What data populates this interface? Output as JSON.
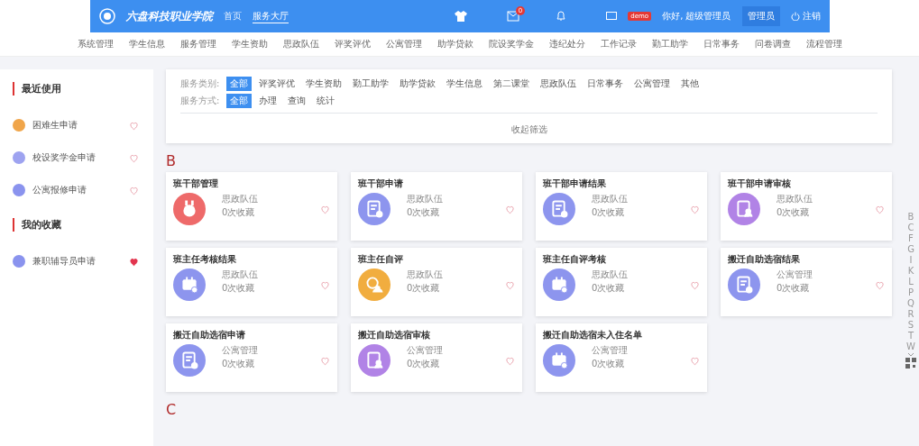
{
  "header": {
    "school_name": "六盘科技职业学院",
    "nav": [
      {
        "label": "首页",
        "selected": false
      },
      {
        "label": "服务大厅",
        "selected": true
      }
    ],
    "mail_badge": "0",
    "demo_badge": "demo",
    "greeting": "你好, 超级管理员",
    "role": "管理员",
    "logout": "注销"
  },
  "menu": [
    "系统管理",
    "学生信息",
    "服务管理",
    "学生资助",
    "思政队伍",
    "评奖评优",
    "公寓管理",
    "助学贷款",
    "院设奖学金",
    "违纪处分",
    "工作记录",
    "勤工助学",
    "日常事务",
    "问卷调查",
    "流程管理"
  ],
  "sidebar": {
    "sections": [
      {
        "title": "最近使用",
        "items": [
          {
            "label": "困难生申请",
            "color": "#f0a54a",
            "favorited": false
          },
          {
            "label": "校设奖学金申请",
            "color": "#9ea3f0",
            "favorited": false
          },
          {
            "label": "公寓报修申请",
            "color": "#8a93ee",
            "favorited": false
          }
        ]
      },
      {
        "title": "我的收藏",
        "items": [
          {
            "label": "兼职辅导员申请",
            "color": "#8a93ee",
            "favorited": true
          }
        ]
      }
    ]
  },
  "filters": [
    {
      "label": "服务类别:",
      "options": [
        {
          "label": "全部",
          "selected": true
        },
        {
          "label": "评奖评优",
          "selected": false
        },
        {
          "label": "学生资助",
          "selected": false
        },
        {
          "label": "勤工助学",
          "selected": false
        },
        {
          "label": "助学贷款",
          "selected": false
        },
        {
          "label": "学生信息",
          "selected": false
        },
        {
          "label": "第二课堂",
          "selected": false
        },
        {
          "label": "思政队伍",
          "selected": false
        },
        {
          "label": "日常事务",
          "selected": false
        },
        {
          "label": "公寓管理",
          "selected": false
        },
        {
          "label": "其他",
          "selected": false
        }
      ]
    },
    {
      "label": "服务方式:",
      "options": [
        {
          "label": "全部",
          "selected": true
        },
        {
          "label": "办理",
          "selected": false
        },
        {
          "label": "查询",
          "selected": false
        },
        {
          "label": "统计",
          "selected": false
        }
      ]
    }
  ],
  "collapse_label": "收起筛选",
  "groups": [
    {
      "letter": "B",
      "cards": [
        {
          "title": "班干部管理",
          "category": "思政队伍",
          "favorites": "0次收藏",
          "kind": "trophy",
          "color": "#ee6a6a",
          "favorited": false
        },
        {
          "title": "班干部申请",
          "category": "思政队伍",
          "favorites": "0次收藏",
          "kind": "document",
          "color": "#8d95ee",
          "favorited": false
        },
        {
          "title": "班干部申请结果",
          "category": "思政队伍",
          "favorites": "0次收藏",
          "kind": "document",
          "color": "#8d95ee",
          "favorited": false
        },
        {
          "title": "班干部申请审核",
          "category": "思政队伍",
          "favorites": "0次收藏",
          "kind": "person",
          "color": "#b183e6",
          "favorited": false
        },
        {
          "title": "班主任考核结果",
          "category": "思政队伍",
          "favorites": "0次收藏",
          "kind": "calendar",
          "color": "#8d95ee",
          "favorited": false
        },
        {
          "title": "班主任自评",
          "category": "思政队伍",
          "favorites": "0次收藏",
          "kind": "clock",
          "color": "#f1ad3f",
          "favorited": false
        },
        {
          "title": "班主任自评考核",
          "category": "思政队伍",
          "favorites": "0次收藏",
          "kind": "calendar",
          "color": "#8d95ee",
          "favorited": false
        },
        {
          "title": "搬迁自助选宿结果",
          "category": "公寓管理",
          "favorites": "0次收藏",
          "kind": "document",
          "color": "#8d95ee",
          "favorited": false
        },
        {
          "title": "搬迁自助选宿申请",
          "category": "公寓管理",
          "favorites": "0次收藏",
          "kind": "document",
          "color": "#8d95ee",
          "favorited": false
        },
        {
          "title": "搬迁自助选宿审核",
          "category": "公寓管理",
          "favorites": "0次收藏",
          "kind": "person",
          "color": "#b183e6",
          "favorited": false
        },
        {
          "title": "搬迁自助选宿未入住名单",
          "category": "公寓管理",
          "favorites": "0次收藏",
          "kind": "calendar",
          "color": "#8d95ee",
          "favorited": false
        }
      ]
    },
    {
      "letter": "C"
    }
  ],
  "alphabet": [
    "B",
    "C",
    "F",
    "G",
    "I",
    "K",
    "L",
    "P",
    "Q",
    "R",
    "S",
    "T",
    "W"
  ]
}
